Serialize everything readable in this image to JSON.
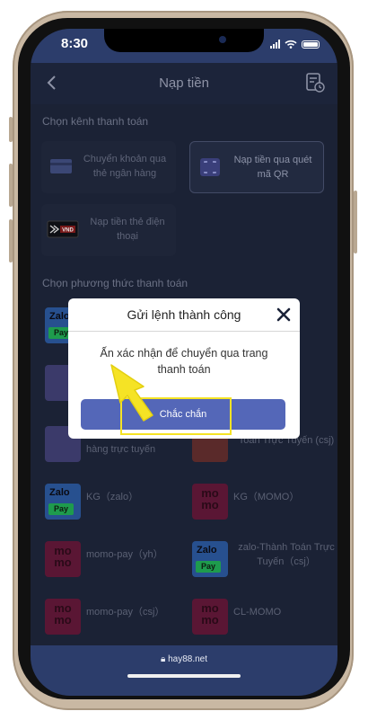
{
  "status_bar": {
    "time": "8:30"
  },
  "header": {
    "title": "Nạp tiền"
  },
  "channels": {
    "section_label": "Chọn kênh thanh toán",
    "items": [
      {
        "label": "Chuyển khoản qua thẻ ngân hàng",
        "icon": "bank-card-icon"
      },
      {
        "label": "Nạp tiền qua quét mã QR",
        "icon": "qr-scan-icon",
        "selected": true
      },
      {
        "label": "Nạp tiền thẻ điện thoại",
        "icon": "vnd-card-icon",
        "badge": "VND"
      }
    ]
  },
  "methods": {
    "section_label": "Chọn phương thức thanh toán",
    "items": [
      {
        "label": "",
        "logo": "zalo"
      },
      {
        "label": "",
        "logo": "momo"
      },
      {
        "label": "",
        "logo": "wallet"
      },
      {
        "label": "",
        "logo": "wallet"
      },
      {
        "label": "hàng trực tuyến",
        "logo": "wallet"
      },
      {
        "label": "Toán Trực Tuyến (csj)",
        "logo": "vietqr"
      },
      {
        "label": "KG（zalo）",
        "logo": "zalo"
      },
      {
        "label": "KG（MOMO）",
        "logo": "momo"
      },
      {
        "label": "momo-pay（yh）",
        "logo": "momo"
      },
      {
        "label": "zalo-Thành Toán Trực Tuyến（csj）",
        "logo": "zalo"
      },
      {
        "label": "momo-pay（csj）",
        "logo": "momo"
      },
      {
        "label": "CL-MOMO",
        "logo": "momo"
      }
    ],
    "logo_text": {
      "zalo_top": "Zalo",
      "zalo_bottom": "Pay",
      "momo_top": "mo",
      "momo_bottom": "mo"
    }
  },
  "modal": {
    "title": "Gửi lệnh thành công",
    "message": "Ấn xác nhận để chuyển qua trang thanh toán",
    "confirm_label": "Chắc chắn"
  },
  "footer": {
    "url": "hay88.net"
  },
  "colors": {
    "accent": "#5467b8",
    "highlight": "#f5e325",
    "bar": "#2c3d6b"
  }
}
